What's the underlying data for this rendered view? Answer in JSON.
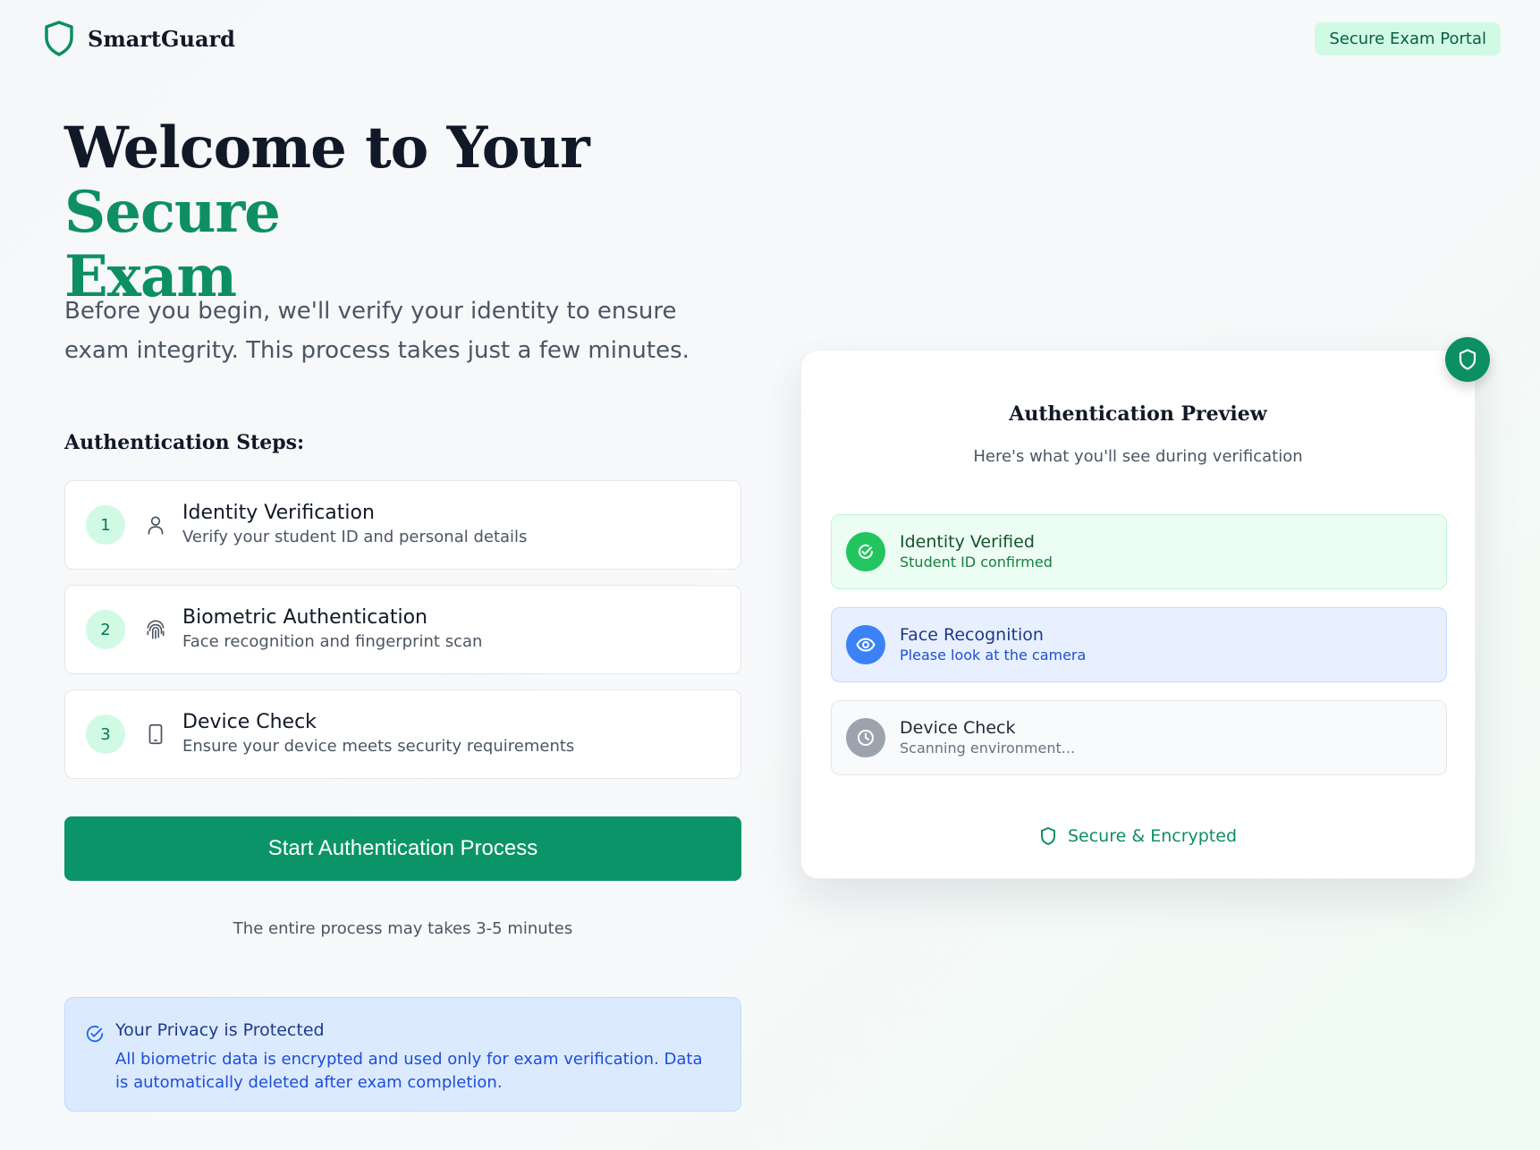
{
  "header": {
    "brand": "SmartGuard",
    "portal_label": "Secure Exam Portal"
  },
  "hero": {
    "title_part1": "Welcome to Your ",
    "title_accent1": "Secure",
    "title_accent2": "Exam",
    "description": "Before you begin, we'll verify your identity to ensure exam integrity. This process takes just a few minutes."
  },
  "steps": {
    "heading": "Authentication Steps:",
    "items": [
      {
        "number": "1",
        "icon": "user-icon",
        "title": "Identity Verification",
        "subtitle": "Verify your student ID and personal details"
      },
      {
        "number": "2",
        "icon": "fingerprint-icon",
        "title": "Biometric Authentication",
        "subtitle": "Face recognition and fingerprint scan"
      },
      {
        "number": "3",
        "icon": "device-icon",
        "title": "Device Check",
        "subtitle": "Ensure your device meets security requirements"
      }
    ]
  },
  "cta": {
    "label": "Start Authentication Process",
    "note": "The entire process may takes 3-5 minutes"
  },
  "privacy": {
    "title": "Your Privacy is Protected",
    "text": "All biometric data is encrypted and used only for exam verification. Data is automatically deleted after exam completion."
  },
  "preview": {
    "title": "Authentication Preview",
    "subtitle": "Here's what you'll see during verification",
    "statuses": [
      {
        "icon": "check-circle-icon",
        "title": "Identity Verified",
        "subtitle": "Student ID confirmed",
        "color": "#22c55e"
      },
      {
        "icon": "eye-icon",
        "title": "Face Recognition",
        "subtitle": "Please look at the camera",
        "color": "#3b82f6"
      },
      {
        "icon": "clock-icon",
        "title": "Device Check",
        "subtitle": "Scanning environment...",
        "color": "#9ca3af"
      }
    ],
    "footer": "Secure & Encrypted"
  },
  "colors": {
    "primary": "#0b9467",
    "accent_text": "#0d8f63",
    "privacy_bg": "#dbeafe"
  }
}
